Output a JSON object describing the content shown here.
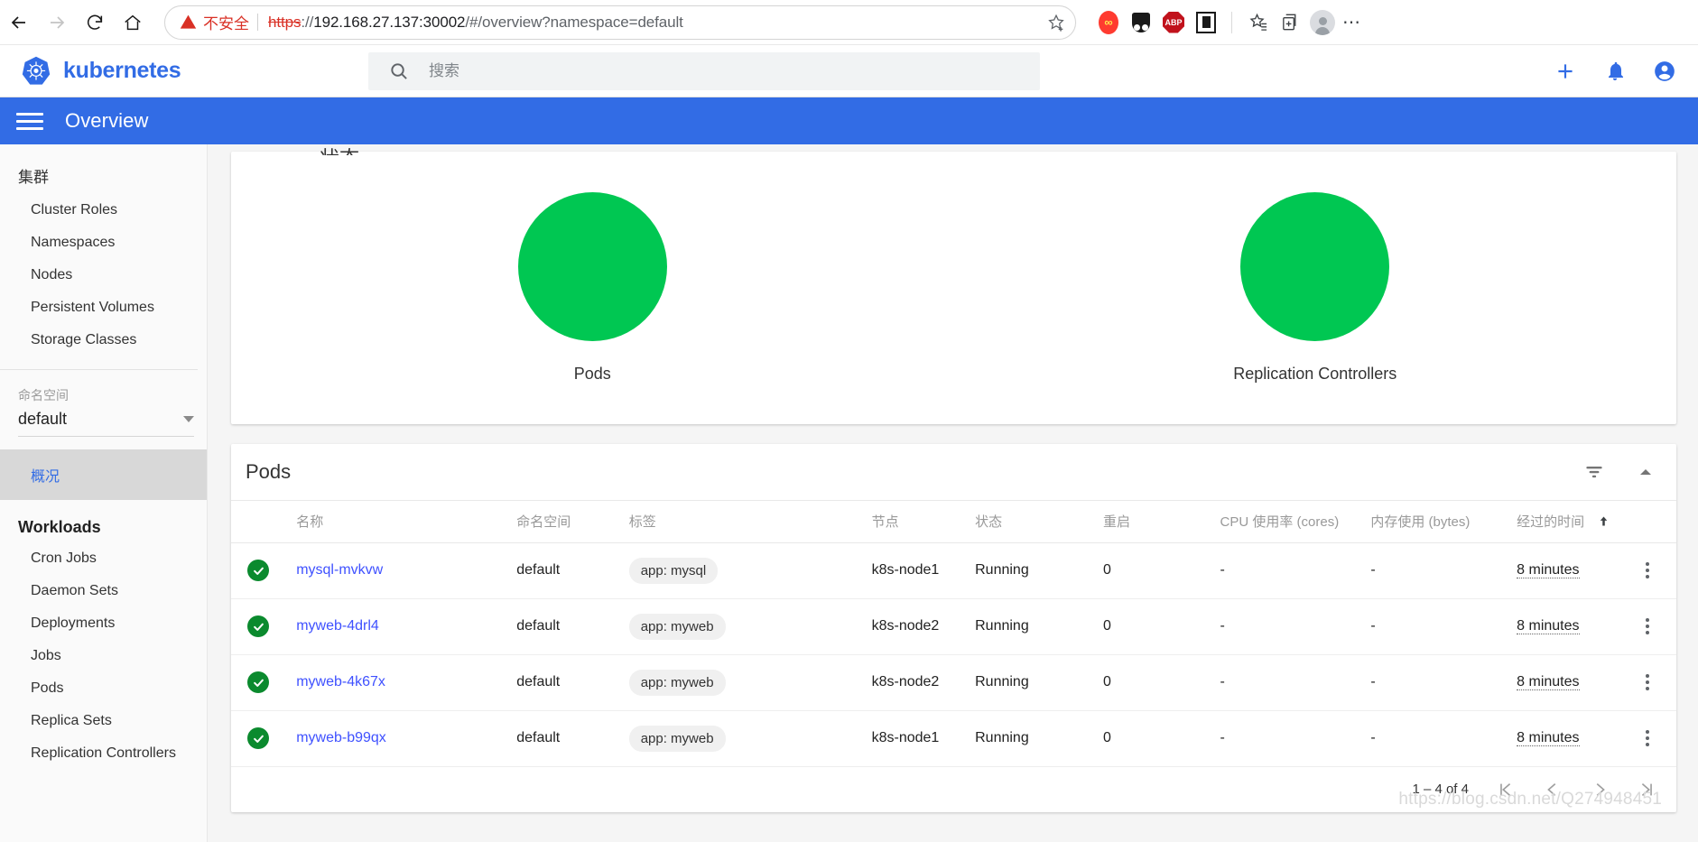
{
  "browser": {
    "back_icon": "arrow-left-icon",
    "forward_icon": "arrow-right-icon",
    "reload_icon": "reload-icon",
    "home_icon": "home-icon",
    "security_label": "不安全",
    "url_scheme": "https",
    "url_host": "192.168.27.137:30002",
    "url_path": "/#/overview?namespace=default",
    "bookmark_icon": "star-plus-icon",
    "extensions": [
      {
        "name": "infinity-extension-icon",
        "glyph": "∞"
      },
      {
        "name": "dark-reader-extension-icon",
        "glyph": ""
      },
      {
        "name": "adblock-plus-extension-icon",
        "glyph": "ABP"
      },
      {
        "name": "reader-mode-extension-icon",
        "glyph": ""
      }
    ],
    "collections_icon": "collections-icon",
    "favorites_icon": "favorites-star-icon",
    "profile_icon": "profile-avatar-icon",
    "more_icon": "more-dots-icon"
  },
  "header": {
    "logo_icon": "kubernetes-helm-logo",
    "brand": "kubernetes",
    "search_icon": "search-icon",
    "search_placeholder": "搜索",
    "search_value": "",
    "add_icon": "plus-icon",
    "notifications_icon": "bell-icon",
    "account_icon": "account-circle-icon"
  },
  "titlebar": {
    "menu_icon": "hamburger-menu-icon",
    "title": "Overview"
  },
  "sidebar": {
    "cluster_group": "集群",
    "cluster_items": [
      {
        "label": "Cluster Roles"
      },
      {
        "label": "Namespaces"
      },
      {
        "label": "Nodes"
      },
      {
        "label": "Persistent Volumes"
      },
      {
        "label": "Storage Classes"
      }
    ],
    "namespace_label": "命名空间",
    "namespace_value": "default",
    "namespace_caret_icon": "chevron-down-icon",
    "overview_item": "概况",
    "workloads_group": "Workloads",
    "workload_items": [
      {
        "label": "Cron Jobs"
      },
      {
        "label": "Daemon Sets"
      },
      {
        "label": "Deployments"
      },
      {
        "label": "Jobs"
      },
      {
        "label": "Pods"
      },
      {
        "label": "Replica Sets"
      },
      {
        "label": "Replication Controllers"
      }
    ]
  },
  "charts_card": {
    "clipped_title": "状态",
    "charts": [
      {
        "label": "Pods",
        "color": "#00c752",
        "percent": 100
      },
      {
        "label": "Replication Controllers",
        "color": "#00c752",
        "percent": 100
      }
    ]
  },
  "pods_card": {
    "title": "Pods",
    "filter_icon": "filter-icon",
    "collapse_icon": "chevron-up-icon",
    "columns": [
      {
        "key": "status_icon",
        "label": ""
      },
      {
        "key": "name",
        "label": "名称"
      },
      {
        "key": "namespace",
        "label": "命名空间"
      },
      {
        "key": "labels",
        "label": "标签"
      },
      {
        "key": "node",
        "label": "节点"
      },
      {
        "key": "state",
        "label": "状态"
      },
      {
        "key": "restarts",
        "label": "重启"
      },
      {
        "key": "cpu",
        "label": "CPU 使用率 (cores)"
      },
      {
        "key": "memory",
        "label": "内存使用 (bytes)"
      },
      {
        "key": "age",
        "label": "经过的时间"
      },
      {
        "key": "menu",
        "label": ""
      }
    ],
    "sort_column": "age",
    "sort_direction_icon": "arrow-up-icon",
    "rows": [
      {
        "status": "ok",
        "name": "mysql-mvkvw",
        "namespace": "default",
        "label": "app: mysql",
        "node": "k8s-node1",
        "state": "Running",
        "restarts": "0",
        "cpu": "-",
        "memory": "-",
        "age": "8 minutes",
        "menu_icon": "kebab-menu-icon"
      },
      {
        "status": "ok",
        "name": "myweb-4drl4",
        "namespace": "default",
        "label": "app: myweb",
        "node": "k8s-node2",
        "state": "Running",
        "restarts": "0",
        "cpu": "-",
        "memory": "-",
        "age": "8 minutes",
        "menu_icon": "kebab-menu-icon"
      },
      {
        "status": "ok",
        "name": "myweb-4k67x",
        "namespace": "default",
        "label": "app: myweb",
        "node": "k8s-node2",
        "state": "Running",
        "restarts": "0",
        "cpu": "-",
        "memory": "-",
        "age": "8 minutes",
        "menu_icon": "kebab-menu-icon"
      },
      {
        "status": "ok",
        "name": "myweb-b99qx",
        "namespace": "default",
        "label": "app: myweb",
        "node": "k8s-node1",
        "state": "Running",
        "restarts": "0",
        "cpu": "-",
        "memory": "-",
        "age": "8 minutes",
        "menu_icon": "kebab-menu-icon"
      }
    ],
    "pagination": {
      "range": "1 – 4 of 4",
      "first_icon": "first-page-icon",
      "prev_icon": "previous-page-icon",
      "next_icon": "next-page-icon",
      "last_icon": "last-page-icon"
    }
  },
  "watermark": "https://blog.csdn.net/Q274948451",
  "colors": {
    "brand_blue": "#326ce5",
    "status_green": "#00c752",
    "link_blue": "#3f51ff",
    "insecure_red": "#d93025"
  }
}
